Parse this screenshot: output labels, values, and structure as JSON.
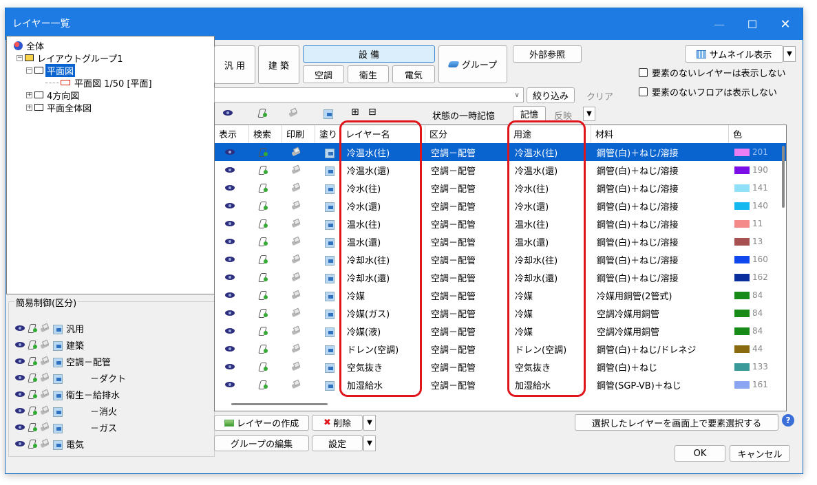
{
  "window": {
    "title": "レイヤー一覧",
    "minimize": "—",
    "maximize": "☐",
    "close": "✕"
  },
  "tree": [
    {
      "label": "全体"
    },
    {
      "label": "レイアウトグループ1"
    },
    {
      "label": "平面図"
    },
    {
      "label": "平面図 1/50 [平面]"
    },
    {
      "label": "4方向図"
    },
    {
      "label": "平面全体図"
    }
  ],
  "simple_control": {
    "title": "簡易制御(区分)",
    "rows": [
      "汎用",
      "建築",
      "空調－配管",
      "－ダクト",
      "衛生－給排水",
      "－消火",
      "－ガス",
      "電気"
    ]
  },
  "toolbar": {
    "general": "汎 用",
    "architecture": "建 築",
    "equipment": "設 備",
    "hvac": "空調",
    "sanitary": "衛生",
    "electric": "電気",
    "group": "グループ",
    "external_ref": "外部参照",
    "thumbnail": "サムネイル表示",
    "hide_empty_layers": "要素のないレイヤーは表示しない",
    "hide_empty_floors": "要素のないフロアは表示しない",
    "filter": "絞り込み",
    "clear": "クリア",
    "plus": "⊞",
    "minus": "⊟",
    "temp_state": "状態の一時記憶",
    "remember": "記憶",
    "reflect": "反映"
  },
  "table": {
    "headers": [
      "表示",
      "検索",
      "印刷",
      "塗り",
      "レイヤー名",
      "区分",
      "用途",
      "材料",
      "色"
    ],
    "rows": [
      {
        "name": "冷温水(往)",
        "cat": "空調－配管",
        "use": "冷温水(往)",
        "mat": "鋼管(白)＋ねじ/溶接",
        "color": "#ea7ef2",
        "cnum": "201"
      },
      {
        "name": "冷温水(還)",
        "cat": "空調－配管",
        "use": "冷温水(還)",
        "mat": "鋼管(白)＋ねじ/溶接",
        "color": "#7b0fe6",
        "cnum": "190"
      },
      {
        "name": "冷水(往)",
        "cat": "空調－配管",
        "use": "冷水(往)",
        "mat": "鋼管(白)＋ねじ/溶接",
        "color": "#8fe0f8",
        "cnum": "141"
      },
      {
        "name": "冷水(還)",
        "cat": "空調－配管",
        "use": "冷水(還)",
        "mat": "鋼管(白)＋ねじ/溶接",
        "color": "#15b9ef",
        "cnum": "140"
      },
      {
        "name": "温水(往)",
        "cat": "空調－配管",
        "use": "温水(往)",
        "mat": "鋼管(白)＋ねじ/溶接",
        "color": "#f58a8a",
        "cnum": "11"
      },
      {
        "name": "温水(還)",
        "cat": "空調－配管",
        "use": "温水(還)",
        "mat": "鋼管(白)＋ねじ/溶接",
        "color": "#a65252",
        "cnum": "13"
      },
      {
        "name": "冷却水(往)",
        "cat": "空調－配管",
        "use": "冷却水(往)",
        "mat": "鋼管(白)＋ねじ/溶接",
        "color": "#1048ee",
        "cnum": "160"
      },
      {
        "name": "冷却水(還)",
        "cat": "空調－配管",
        "use": "冷却水(還)",
        "mat": "鋼管(白)＋ねじ/溶接",
        "color": "#0a2e9c",
        "cnum": "162"
      },
      {
        "name": "冷媒",
        "cat": "空調－配管",
        "use": "冷媒",
        "mat": "冷媒用銅管(2管式)",
        "color": "#188a18",
        "cnum": "84"
      },
      {
        "name": "冷媒(ガス)",
        "cat": "空調－配管",
        "use": "冷媒",
        "mat": "空調冷媒用銅管",
        "color": "#188a18",
        "cnum": "84"
      },
      {
        "name": "冷媒(液)",
        "cat": "空調－配管",
        "use": "冷媒",
        "mat": "空調冷媒用銅管",
        "color": "#188a18",
        "cnum": "84"
      },
      {
        "name": "ドレン(空調)",
        "cat": "空調－配管",
        "use": "ドレン(空調)",
        "mat": "鋼管(白)＋ねじ/ドレネジ",
        "color": "#8a6a0e",
        "cnum": "44"
      },
      {
        "name": "空気抜き",
        "cat": "空調－配管",
        "use": "空気抜き",
        "mat": "鋼管(白)＋ねじ",
        "color": "#3a9a9a",
        "cnum": "133"
      },
      {
        "name": "加湿給水",
        "cat": "空調－配管",
        "use": "加湿給水",
        "mat": "鋼管(SGP-VB)＋ねじ",
        "color": "#8aa6f0",
        "cnum": "161"
      }
    ]
  },
  "bottom": {
    "create_layer": "レイヤーの作成",
    "delete": "削除",
    "edit_group": "グループの編集",
    "settings": "設定",
    "select_on_screen": "選択したレイヤーを画面上で要素選択する",
    "help": "?",
    "ok": "OK",
    "cancel": "キャンセル"
  }
}
